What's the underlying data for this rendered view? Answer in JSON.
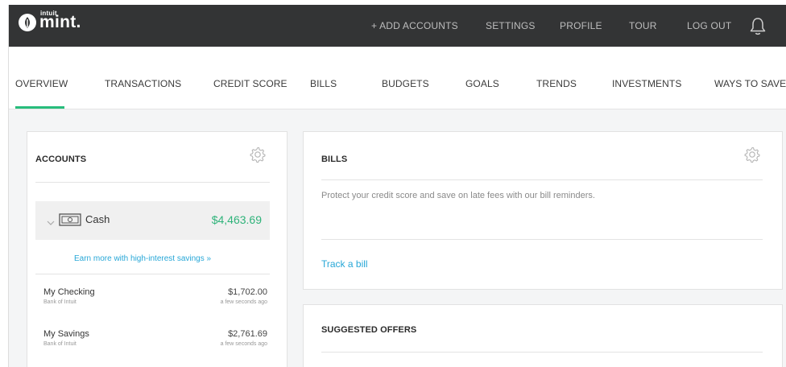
{
  "brand": {
    "top": "intuit",
    "name": "mint."
  },
  "topnav": {
    "add_accounts": "+ ADD ACCOUNTS",
    "settings": "SETTINGS",
    "profile": "PROFILE",
    "tour": "TOUR",
    "logout": "LOG OUT",
    "bell_icon": "bell-icon"
  },
  "subnav": {
    "overview": "OVERVIEW",
    "transactions": "TRANSACTIONS",
    "credit_score": "CREDIT SCORE",
    "bills": "BILLS",
    "budgets": "BUDGETS",
    "goals": "GOALS",
    "trends": "TRENDS",
    "investments": "INVESTMENTS",
    "ways_to_save": "WAYS TO SAVE",
    "active": "OVERVIEW"
  },
  "accounts": {
    "title": "ACCOUNTS",
    "cash": {
      "label": "Cash",
      "amount": "$4,463.69"
    },
    "promo_link": "Earn more with high-interest savings »",
    "items": [
      {
        "name": "My Checking",
        "institution": "Bank of Intuit",
        "amount": "$1,702.00",
        "updated": "a few seconds ago"
      },
      {
        "name": "My Savings",
        "institution": "Bank of Intuit",
        "amount": "$2,761.69",
        "updated": "a few seconds ago"
      }
    ]
  },
  "bills": {
    "title": "BILLS",
    "message": "Protect your credit score and save on late fees with our bill reminders.",
    "link": "Track a bill"
  },
  "offers": {
    "title": "SUGGESTED OFFERS"
  },
  "colors": {
    "topbar": "#333435",
    "accent_green": "#28bd7c",
    "amount_green": "#2fb37a",
    "link_blue": "#27a7d7"
  }
}
